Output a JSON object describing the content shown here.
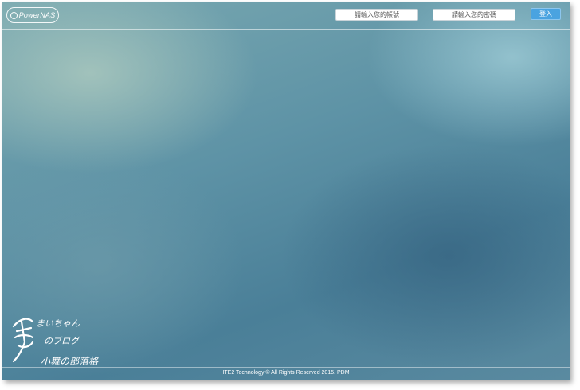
{
  "header": {
    "logo_text": "PowerNAS",
    "account_placeholder": "請輸入您的帳號",
    "password_placeholder": "請輸入您的密碼",
    "login_label": "登入"
  },
  "footer": {
    "copyright": "ITE2 Technology © All Rights Reserved 2015. PDM"
  },
  "watermark": {
    "line1": "まいちゃん",
    "line2": "のブログ",
    "line3": "小舞の部落格"
  },
  "colors": {
    "accent": "#4aa3e0",
    "background": "#5e93a6"
  }
}
